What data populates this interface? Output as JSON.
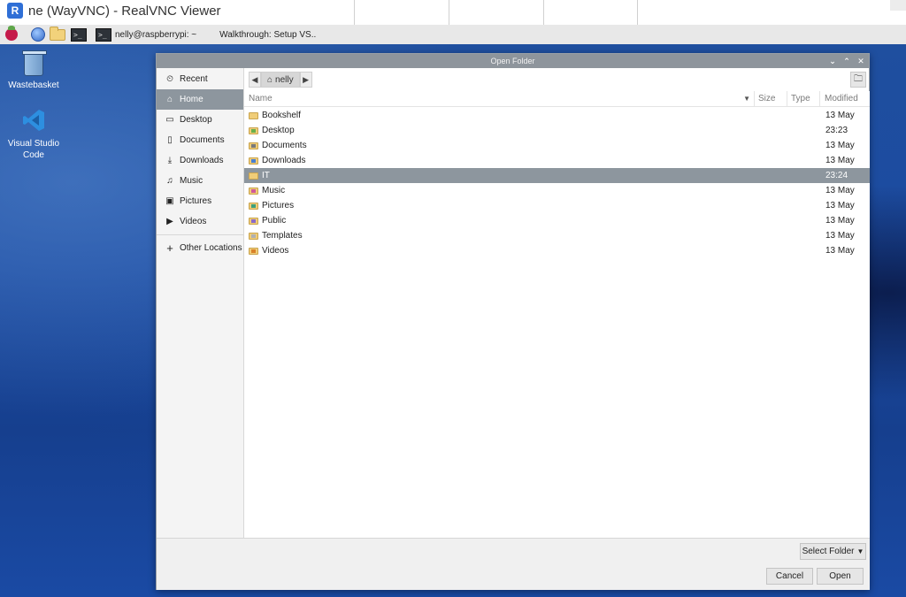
{
  "vnc": {
    "logo_text": "R",
    "title": "ne (WayVNC) - RealVNC Viewer"
  },
  "panel": {
    "icons": [
      "raspberry-pi-menu-icon",
      "web-browser-icon",
      "file-manager-icon",
      "terminal-icon"
    ],
    "task1_label": "nelly@raspberrypi: ~",
    "task2_label": "Walkthrough: Setup VS.."
  },
  "desktop": {
    "items": [
      {
        "label": "Wastebasket",
        "icon": "wastebasket-icon"
      },
      {
        "label": "Visual Studio Code",
        "icon": "vscode-icon"
      }
    ]
  },
  "dialog": {
    "title": "Open Folder",
    "controls": {
      "minimize": "⌄",
      "maximize": "⌃",
      "close": "✕"
    },
    "sidebar": [
      {
        "label": "Recent",
        "icon": "⏲",
        "selected": false
      },
      {
        "label": "Home",
        "icon": "⌂",
        "selected": true
      },
      {
        "label": "Desktop",
        "icon": "▭",
        "selected": false
      },
      {
        "label": "Documents",
        "icon": "▯",
        "selected": false
      },
      {
        "label": "Downloads",
        "icon": "⤓",
        "selected": false
      },
      {
        "label": "Music",
        "icon": "♫",
        "selected": false
      },
      {
        "label": "Pictures",
        "icon": "▣",
        "selected": false
      },
      {
        "label": "Videos",
        "icon": "▶",
        "selected": false
      }
    ],
    "other_locations": {
      "label": "Other Locations",
      "icon": "+"
    },
    "pathbar": {
      "back": "◀",
      "crumb": "nelly",
      "forward": "▶",
      "new_folder": "🗀"
    },
    "columns": {
      "name": "Name",
      "size": "Size",
      "type": "Type",
      "modified": "Modified"
    },
    "files": [
      {
        "name": "Bookshelf",
        "modified": "13 May",
        "selected": false,
        "emblem": ""
      },
      {
        "name": "Desktop",
        "modified": "23:23",
        "selected": false,
        "emblem": "#6ab04c"
      },
      {
        "name": "Documents",
        "modified": "13 May",
        "selected": false,
        "emblem": "#7a7a7a"
      },
      {
        "name": "Downloads",
        "modified": "13 May",
        "selected": false,
        "emblem": "#4a7fd0"
      },
      {
        "name": "IT",
        "modified": "23:24",
        "selected": true,
        "emblem": ""
      },
      {
        "name": "Music",
        "modified": "13 May",
        "selected": false,
        "emblem": "#d05a9a"
      },
      {
        "name": "Pictures",
        "modified": "13 May",
        "selected": false,
        "emblem": "#3fa07c"
      },
      {
        "name": "Public",
        "modified": "13 May",
        "selected": false,
        "emblem": "#8a6bc9"
      },
      {
        "name": "Templates",
        "modified": "13 May",
        "selected": false,
        "emblem": "#b0b0b0"
      },
      {
        "name": "Videos",
        "modified": "13 May",
        "selected": false,
        "emblem": "#d9822b"
      }
    ],
    "footer": {
      "select_folder": "Select Folder",
      "cancel": "Cancel",
      "open": "Open"
    }
  }
}
